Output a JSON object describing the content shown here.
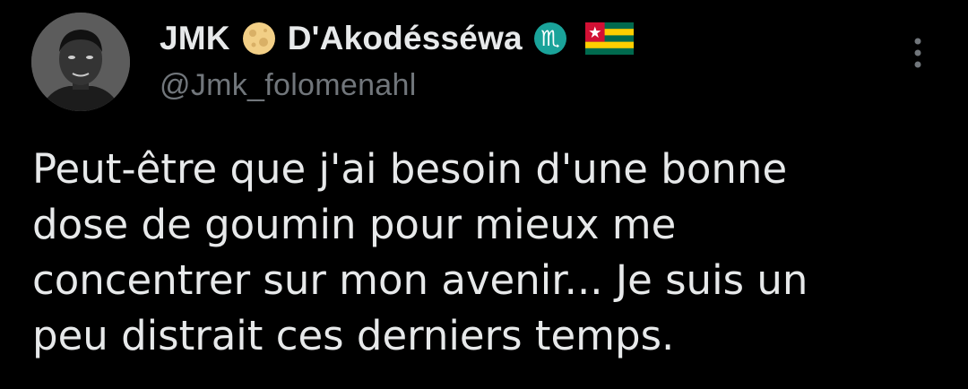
{
  "tweet": {
    "author": {
      "name_part1": "JMK",
      "name_part2": "D'Akodésséwa",
      "handle": "@Jmk_folomenahl",
      "name_emojis": [
        "full-moon-emoji",
        "scorpio-sign-emoji",
        "togo-flag-emoji"
      ]
    },
    "text_lines": [
      "Peut-être que j'ai besoin d'une bonne",
      "dose de goumin pour mieux me",
      "concentrer sur mon avenir... Je suis un",
      "peu distrait ces derniers temps."
    ]
  },
  "colors": {
    "background": "#000000",
    "primary_text": "#e7e9ea",
    "secondary_text": "#71767b",
    "zodiac_badge": "#1aa39a"
  },
  "icons": {
    "more_menu": "vertical-ellipsis-icon"
  }
}
